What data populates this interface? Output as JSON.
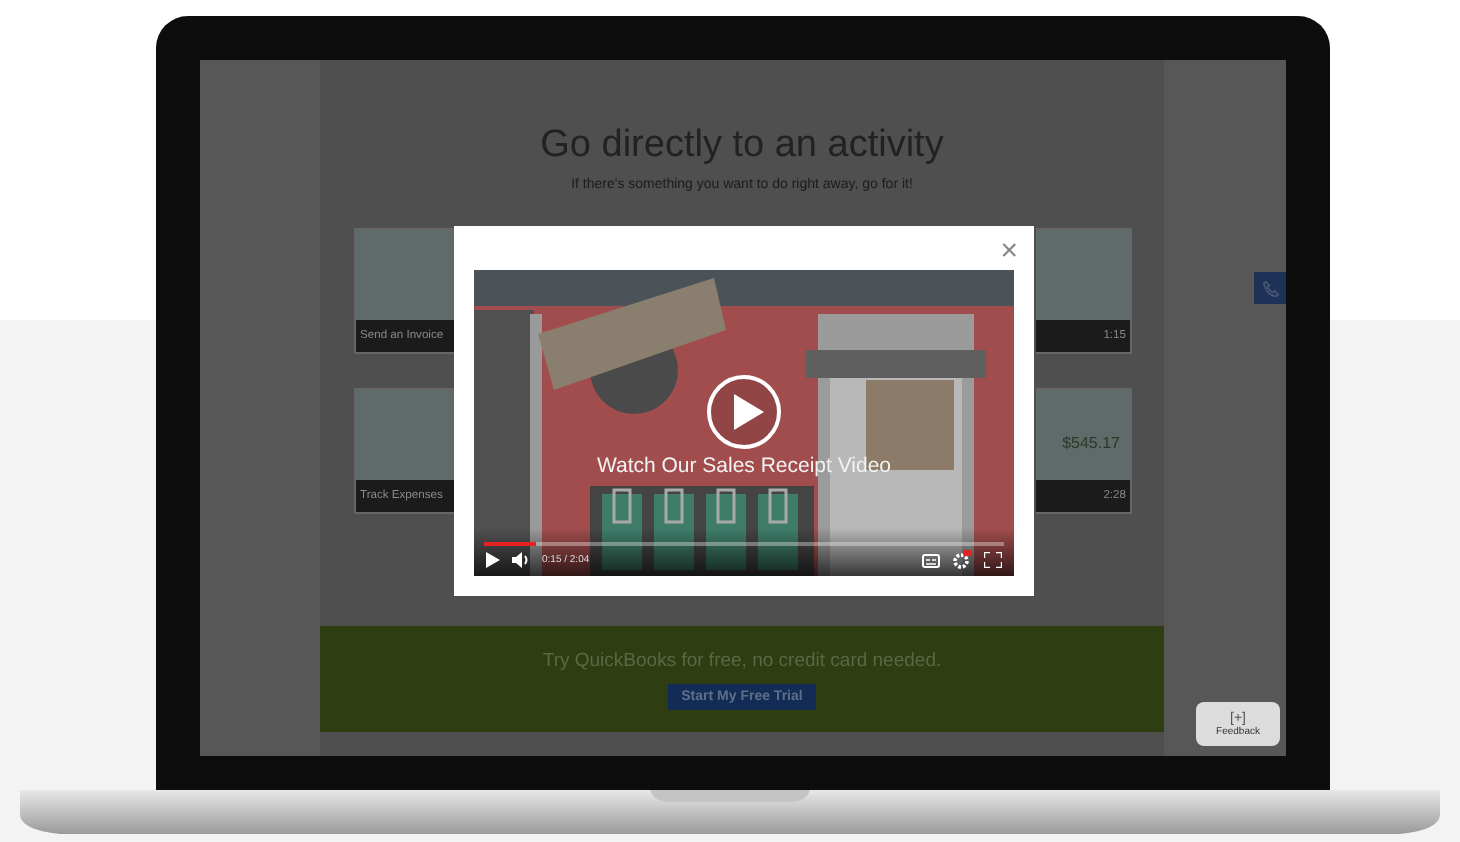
{
  "page": {
    "heading": "Go directly to an activity",
    "subheading": "If there's something you want to do right away, go for it!"
  },
  "left_cards": [
    {
      "label": "Send an Invoice"
    },
    {
      "label": "Track Expenses"
    }
  ],
  "right_cards": [
    {
      "duration": "1:15"
    },
    {
      "amount": "$545.17",
      "duration": "2:28"
    }
  ],
  "trial_banner": {
    "text": "Try QuickBooks for free, no credit card needed.",
    "button": "Start My Free Trial"
  },
  "video_modal": {
    "close": "×",
    "title": "Watch Our Sales Receipt Video",
    "time": "0:15 / 2:04",
    "progress": {
      "level": 0.1
    }
  },
  "feedback": {
    "icon_text": "[+]",
    "label": "Feedback"
  }
}
